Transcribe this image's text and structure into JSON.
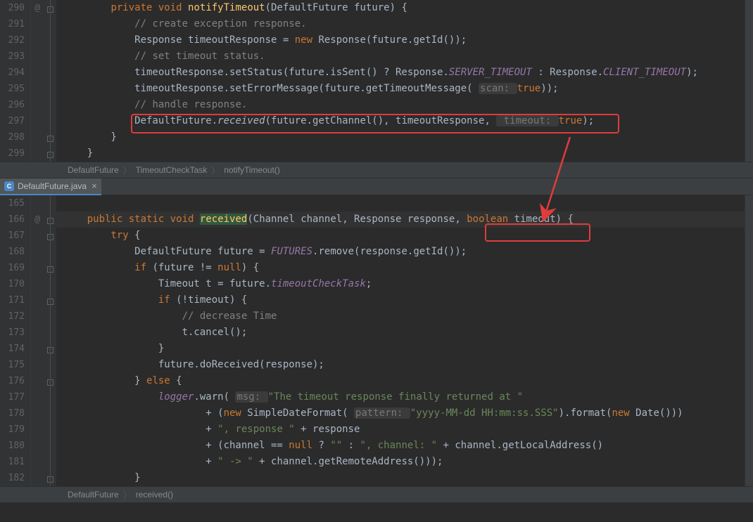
{
  "pane1": {
    "lines": [
      "290",
      "291",
      "292",
      "293",
      "294",
      "295",
      "296",
      "297",
      "298",
      "299"
    ],
    "ann": {
      "290": "@"
    },
    "code": {
      "290": [
        {
          "t": "        ",
          "c": ""
        },
        {
          "t": "private ",
          "c": "k-private"
        },
        {
          "t": "void ",
          "c": "k-void"
        },
        {
          "t": "notifyTimeout",
          "c": "k-def"
        },
        {
          "t": "(DefaultFuture future) {",
          "c": ""
        }
      ],
      "291": [
        {
          "t": "            ",
          "c": ""
        },
        {
          "t": "// create exception response.",
          "c": "k-comment"
        }
      ],
      "292": [
        {
          "t": "            Response timeoutResponse = ",
          "c": ""
        },
        {
          "t": "new ",
          "c": "k-new"
        },
        {
          "t": "Response(future.getId());",
          "c": ""
        }
      ],
      "293": [
        {
          "t": "            ",
          "c": ""
        },
        {
          "t": "// set timeout status.",
          "c": "k-comment"
        }
      ],
      "294": [
        {
          "t": "            timeoutResponse.setStatus(future.isSent() ? Response.",
          "c": ""
        },
        {
          "t": "SERVER_TIMEOUT",
          "c": "k-const"
        },
        {
          "t": " : Response.",
          "c": ""
        },
        {
          "t": "CLIENT_TIMEOUT",
          "c": "k-const"
        },
        {
          "t": ");",
          "c": ""
        }
      ],
      "295": [
        {
          "t": "            timeoutResponse.setErrorMessage(future.getTimeoutMessage( ",
          "c": ""
        },
        {
          "t": "scan: ",
          "c": "k-hint-bg"
        },
        {
          "t": "true",
          "c": "k-true"
        },
        {
          "t": "));",
          "c": ""
        }
      ],
      "296": [
        {
          "t": "            ",
          "c": ""
        },
        {
          "t": "// handle response.",
          "c": "k-comment"
        }
      ],
      "297": [
        {
          "t": "            DefaultFuture.",
          "c": ""
        },
        {
          "t": "received",
          "c": "k-static-call"
        },
        {
          "t": "(future.getChannel(), timeoutResponse, ",
          "c": ""
        },
        {
          "t": " timeout: ",
          "c": "k-hint-bg"
        },
        {
          "t": "true",
          "c": "k-true"
        },
        {
          "t": ");",
          "c": ""
        }
      ],
      "298": [
        {
          "t": "        }",
          "c": ""
        }
      ],
      "299": [
        {
          "t": "    }",
          "c": ""
        }
      ]
    },
    "breadcrumb": [
      "DefaultFuture",
      "TimeoutCheckTask",
      "notifyTimeout()"
    ]
  },
  "tab": {
    "filename": "DefaultFuture.java",
    "icon_letter": "C"
  },
  "pane2": {
    "lines": [
      "165",
      "166",
      "167",
      "168",
      "169",
      "170",
      "171",
      "172",
      "173",
      "174",
      "175",
      "176",
      "177",
      "178",
      "179",
      "180",
      "181",
      "182"
    ],
    "ann": {
      "166": "@"
    },
    "current_line": "166",
    "code": {
      "165": [
        {
          "t": "",
          "c": ""
        }
      ],
      "166": [
        {
          "t": "    ",
          "c": ""
        },
        {
          "t": "public ",
          "c": "k-public"
        },
        {
          "t": "static ",
          "c": "k-static"
        },
        {
          "t": "void ",
          "c": "k-void"
        },
        {
          "t": "received",
          "c": "k-highlight-def"
        },
        {
          "t": "(Channel channel, Response response, ",
          "c": ""
        },
        {
          "t": "boolean ",
          "c": "k-boolean-type"
        },
        {
          "t": "timeout",
          "c": ""
        },
        {
          "t": ") {",
          "c": ""
        }
      ],
      "167": [
        {
          "t": "        ",
          "c": ""
        },
        {
          "t": "try ",
          "c": "k-private"
        },
        {
          "t": "{",
          "c": ""
        }
      ],
      "168": [
        {
          "t": "            DefaultFuture future = ",
          "c": ""
        },
        {
          "t": "FUTURES",
          "c": "k-const"
        },
        {
          "t": ".remove(response.getId());",
          "c": ""
        }
      ],
      "169": [
        {
          "t": "            ",
          "c": ""
        },
        {
          "t": "if ",
          "c": "k-if"
        },
        {
          "t": "(future != ",
          "c": ""
        },
        {
          "t": "null",
          "c": "k-null"
        },
        {
          "t": ") {",
          "c": ""
        }
      ],
      "170": [
        {
          "t": "                Timeout t = future.",
          "c": ""
        },
        {
          "t": "timeoutCheckTask",
          "c": "k-ital"
        },
        {
          "t": ";",
          "c": ""
        }
      ],
      "171": [
        {
          "t": "                ",
          "c": ""
        },
        {
          "t": "if ",
          "c": "k-if"
        },
        {
          "t": "(!timeout) {",
          "c": ""
        }
      ],
      "172": [
        {
          "t": "                    ",
          "c": ""
        },
        {
          "t": "// decrease Time",
          "c": "k-comment"
        }
      ],
      "173": [
        {
          "t": "                    t.cancel();",
          "c": ""
        }
      ],
      "174": [
        {
          "t": "                }",
          "c": ""
        }
      ],
      "175": [
        {
          "t": "                future.doReceived(response);",
          "c": ""
        }
      ],
      "176": [
        {
          "t": "            } ",
          "c": ""
        },
        {
          "t": "else ",
          "c": "k-else"
        },
        {
          "t": "{",
          "c": ""
        }
      ],
      "177": [
        {
          "t": "                ",
          "c": ""
        },
        {
          "t": "logger",
          "c": "k-const"
        },
        {
          "t": ".warn( ",
          "c": ""
        },
        {
          "t": "msg: ",
          "c": "k-hint-bg"
        },
        {
          "t": "\"The timeout response finally returned at \"",
          "c": "k-str"
        }
      ],
      "178": [
        {
          "t": "                        + (",
          "c": ""
        },
        {
          "t": "new ",
          "c": "k-new"
        },
        {
          "t": "SimpleDateFormat( ",
          "c": ""
        },
        {
          "t": "pattern: ",
          "c": "k-hint-bg"
        },
        {
          "t": "\"yyyy-MM-dd HH:mm:ss.SSS\"",
          "c": "k-str"
        },
        {
          "t": ").format(",
          "c": ""
        },
        {
          "t": "new ",
          "c": "k-new"
        },
        {
          "t": "Date()))",
          "c": ""
        }
      ],
      "179": [
        {
          "t": "                        + ",
          "c": ""
        },
        {
          "t": "\", response \"",
          "c": "k-str"
        },
        {
          "t": " + response",
          "c": ""
        }
      ],
      "180": [
        {
          "t": "                        + (channel == ",
          "c": ""
        },
        {
          "t": "null ",
          "c": "k-null"
        },
        {
          "t": "? ",
          "c": ""
        },
        {
          "t": "\"\"",
          "c": "k-str"
        },
        {
          "t": " : ",
          "c": ""
        },
        {
          "t": "\", channel: \"",
          "c": "k-str"
        },
        {
          "t": " + channel.getLocalAddress()",
          "c": ""
        }
      ],
      "181": [
        {
          "t": "                        + ",
          "c": ""
        },
        {
          "t": "\" -> \"",
          "c": "k-str"
        },
        {
          "t": " + channel.getRemoteAddress()));",
          "c": ""
        }
      ],
      "182": [
        {
          "t": "            }",
          "c": ""
        }
      ]
    },
    "breadcrumb": [
      "DefaultFuture",
      "received()"
    ]
  }
}
